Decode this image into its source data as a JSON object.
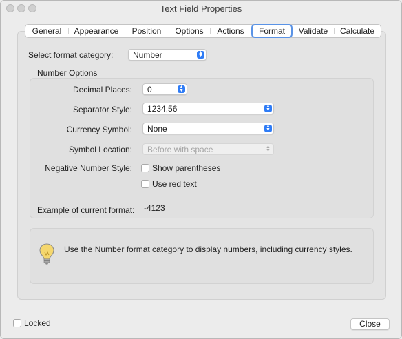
{
  "window": {
    "title": "Text Field Properties"
  },
  "tabs": [
    {
      "label": "General"
    },
    {
      "label": "Appearance"
    },
    {
      "label": "Position"
    },
    {
      "label": "Options"
    },
    {
      "label": "Actions"
    },
    {
      "label": "Format",
      "selected": true
    },
    {
      "label": "Validate"
    },
    {
      "label": "Calculate"
    }
  ],
  "format": {
    "category_label": "Select format category:",
    "category_value": "Number",
    "number_options_title": "Number Options",
    "decimal_places_label": "Decimal Places:",
    "decimal_places_value": "0",
    "separator_style_label": "Separator Style:",
    "separator_style_value": "1234,56",
    "currency_symbol_label": "Currency Symbol:",
    "currency_symbol_value": "None",
    "symbol_location_label": "Symbol Location:",
    "symbol_location_value": "Before with space",
    "negative_style_label": "Negative Number Style:",
    "show_parentheses_label": "Show parentheses",
    "use_red_text_label": "Use red text",
    "example_label": "Example of current format:",
    "example_value": "-4123",
    "info_text": "Use the Number format category to display numbers, including currency styles."
  },
  "footer": {
    "locked_label": "Locked",
    "close_label": "Close"
  },
  "colors": {
    "accent": "#2f7cf6",
    "tab_focus": "#5a93e6",
    "bulb": "#f5d76e"
  },
  "icons": {
    "info": "lightbulb-icon",
    "popup": "up-down-chevron-icon"
  }
}
